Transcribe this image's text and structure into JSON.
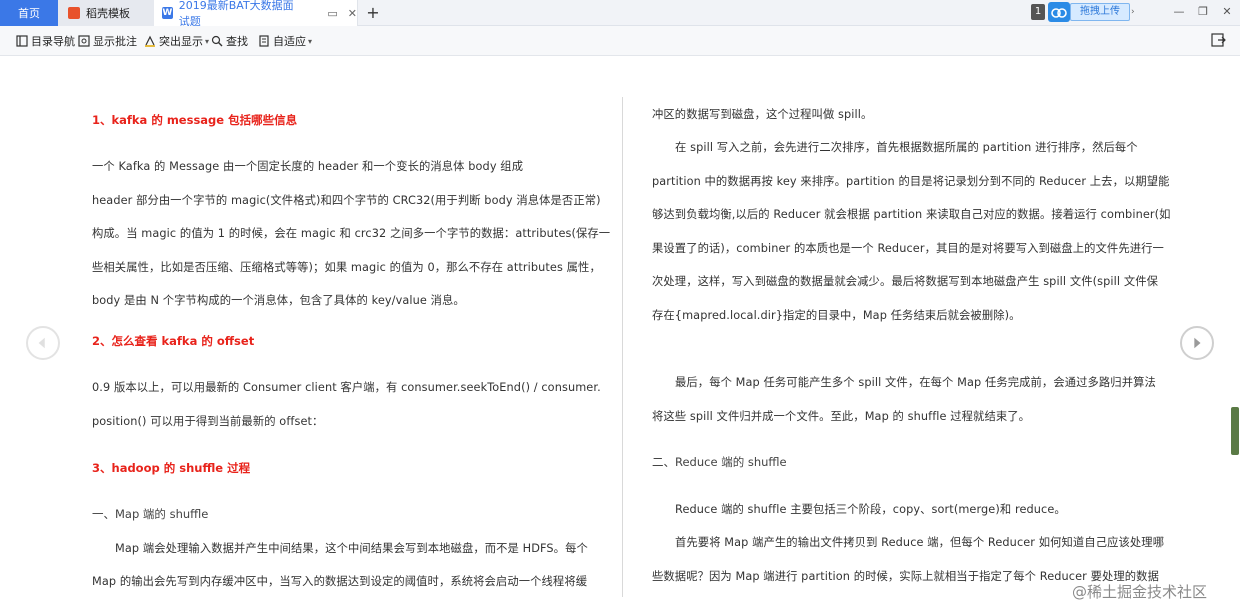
{
  "tabs": {
    "home": "首页",
    "daoke": "稻壳模板",
    "doc": "2019最新BAT大数据面试题",
    "add": "+"
  },
  "topright": {
    "badge": "1",
    "upload": "拖拽上传",
    "minimize": "—",
    "restore": "❐",
    "close": "✕"
  },
  "toolbar": {
    "toc": "目录导航",
    "comments": "显示批注",
    "highlight": "突出显示",
    "find": "查找",
    "fit": "自适应"
  },
  "left_page": {
    "h1": "1、kafka 的 message 包括哪些信息",
    "p1": [
      "一个 Kafka 的 Message 由一个固定长度的 header 和一个变长的消息体 body 组成",
      "header 部分由一个字节的 magic(文件格式)和四个字节的 CRC32(用于判断 body 消息体是否正常)",
      "构成。当 magic 的值为 1 的时候，会在 magic 和 crc32 之间多一个字节的数据：attributes(保存一",
      "些相关属性，比如是否压缩、压缩格式等等)；如果 magic 的值为 0，那么不存在 attributes 属性，",
      "body 是由 N 个字节构成的一个消息体，包含了具体的 key/value 消息。"
    ],
    "h2": "2、怎么查看 kafka 的 offset",
    "p2": [
      "0.9 版本以上，可以用最新的 Consumer  client  客户端，有 consumer.seekToEnd()  /  consumer.",
      "position()  可以用于得到当前最新的 offset："
    ],
    "h3": "3、hadoop 的 shuffle 过程",
    "sub1": "一、Map 端的 shuffle",
    "p3": [
      "Map 端会处理输入数据并产生中间结果，这个中间结果会写到本地磁盘，而不是 HDFS。每个",
      "Map 的输出会先写到内存缓冲区中，当写入的数据达到设定的阈值时，系统将会启动一个线程将缓"
    ]
  },
  "right_page": {
    "p1": "冲区的数据写到磁盘，这个过程叫做 spill。",
    "p2": [
      "在 spill 写入之前，会先进行二次排序，首先根据数据所属的 partition 进行排序，然后每个",
      "partition 中的数据再按 key 来排序。partition 的目是将记录划分到不同的 Reducer 上去，以期望能",
      "够达到负载均衡,以后的 Reducer 就会根据 partition 来读取自己对应的数据。接着运行 combiner(如",
      "果设置了的话)，combiner 的本质也是一个 Reducer，其目的是对将要写入到磁盘上的文件先进行一",
      "次处理，这样，写入到磁盘的数据量就会减少。最后将数据写到本地磁盘产生 spill 文件(spill 文件保",
      "存在{mapred.local.dir}指定的目录中，Map 任务结束后就会被删除)。"
    ],
    "p3": [
      "最后，每个 Map 任务可能产生多个 spill 文件，在每个 Map 任务完成前，会通过多路归并算法",
      "将这些 spill 文件归并成一个文件。至此，Map 的 shuffle 过程就结束了。"
    ],
    "sub2": "二、Reduce 端的 shuffle",
    "p4": "Reduce 端的 shuffle 主要包括三个阶段，copy、sort(merge)和 reduce。",
    "p5": [
      "首先要将 Map 端产生的输出文件拷贝到 Reduce 端，但每个 Reducer 如何知道自己应该处理哪",
      "些数据呢？因为 Map 端进行 partition 的时候，实际上就相当于指定了每个 Reducer 要处理的数据"
    ]
  },
  "watermark": "@稀土掘金技术社区"
}
